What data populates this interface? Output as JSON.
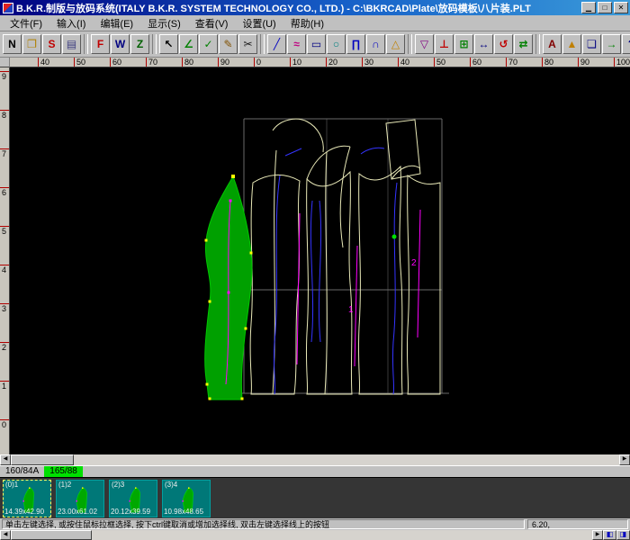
{
  "window": {
    "title": "B.K.R.制版与放码系统(ITALY B.K.R. SYSTEM TECHNOLOGY CO., LTD.) - C:\\BKRCAD\\Plate\\放码模板\\八片装.PLT",
    "buttons": {
      "minimize": "▁",
      "maximize": "□",
      "close": "✕"
    }
  },
  "menu": {
    "items": [
      {
        "name": "file",
        "label": "文件(F)"
      },
      {
        "name": "input",
        "label": "输入(I)"
      },
      {
        "name": "edit",
        "label": "编辑(E)"
      },
      {
        "name": "display",
        "label": "显示(S)"
      },
      {
        "name": "view",
        "label": "查看(V)"
      },
      {
        "name": "settings",
        "label": "设置(U)"
      },
      {
        "name": "help",
        "label": "帮助(H)"
      }
    ]
  },
  "toolbar": {
    "items": [
      {
        "name": "new",
        "glyph": "N",
        "color": "#000000"
      },
      {
        "name": "open",
        "glyph": "❐",
        "color": "#b08000"
      },
      {
        "name": "save",
        "glyph": "S",
        "color": "#c00000"
      },
      {
        "name": "print",
        "glyph": "▤",
        "color": "#404080"
      },
      {
        "sep": true
      },
      {
        "name": "pattern-f",
        "glyph": "F",
        "color": "#c00000"
      },
      {
        "name": "pattern-w",
        "glyph": "W",
        "color": "#000080"
      },
      {
        "name": "zoom",
        "glyph": "Z",
        "color": "#006000"
      },
      {
        "sep": true
      },
      {
        "name": "select",
        "glyph": "↖",
        "color": "#000000"
      },
      {
        "name": "measure-angle",
        "glyph": "∠",
        "color": "#008000"
      },
      {
        "name": "confirm",
        "glyph": "✓",
        "color": "#008000"
      },
      {
        "name": "pencil",
        "glyph": "✎",
        "color": "#805000"
      },
      {
        "name": "scissors",
        "glyph": "✂",
        "color": "#202020"
      },
      {
        "sep": true
      },
      {
        "name": "line",
        "glyph": "╱",
        "color": "#0000c0"
      },
      {
        "name": "curve",
        "glyph": "≈",
        "color": "#c00080"
      },
      {
        "name": "rectangle",
        "glyph": "▭",
        "color": "#000080"
      },
      {
        "name": "circle",
        "glyph": "○",
        "color": "#008080"
      },
      {
        "name": "pi-tool",
        "glyph": "∏",
        "color": "#0000c0"
      },
      {
        "name": "arc",
        "glyph": "∩",
        "color": "#0000c0"
      },
      {
        "name": "triangle",
        "glyph": "△",
        "color": "#c08000"
      },
      {
        "sep": true
      },
      {
        "name": "dart",
        "glyph": "▽",
        "color": "#800080"
      },
      {
        "name": "notch",
        "glyph": "⊥",
        "color": "#c00000"
      },
      {
        "name": "grade-table",
        "glyph": "⊞",
        "color": "#008000"
      },
      {
        "name": "move",
        "glyph": "↔",
        "color": "#000080"
      },
      {
        "name": "rotate",
        "glyph": "↺",
        "color": "#c00000"
      },
      {
        "name": "mirror",
        "glyph": "⇄",
        "color": "#008000"
      },
      {
        "sep": true
      },
      {
        "name": "text",
        "glyph": "A",
        "color": "#800000"
      },
      {
        "name": "grading",
        "glyph": "▲",
        "color": "#c08000"
      },
      {
        "name": "layers",
        "glyph": "❏",
        "color": "#000080"
      },
      {
        "name": "export",
        "glyph": "→",
        "color": "#008000"
      },
      {
        "name": "help-tool",
        "glyph": "?",
        "color": "#000080"
      }
    ]
  },
  "rulers": {
    "horizontal": [
      "40",
      "50",
      "60",
      "70",
      "80",
      "90",
      "0",
      "10",
      "20",
      "30",
      "40",
      "50",
      "60",
      "70",
      "80",
      "90",
      "100"
    ],
    "vertical": [
      "9",
      "8",
      "7",
      "6",
      "5",
      "4",
      "3",
      "2",
      "1",
      "0"
    ]
  },
  "canvas": {
    "annotations": [
      {
        "text": "1"
      },
      {
        "text": "2"
      }
    ],
    "colors": {
      "background": "#000000",
      "pattern_outline": "#e9e9b8",
      "construction_grid": "#6a6a6a",
      "curve_line": "#3434ff",
      "grading_line": "#ff00ff",
      "selected_piece_fill": "#00a000",
      "grading_point": "#ffff00",
      "snap_point": "#00e000"
    }
  },
  "scrollbars": {
    "left": "◀",
    "right": "▶"
  },
  "bottom_buttons": [
    {
      "name": "piece-nav-left",
      "glyph": "◧"
    },
    {
      "name": "piece-nav-right",
      "glyph": "◨"
    }
  ],
  "size_bar": {
    "tabs": [
      {
        "label": "160/84A",
        "selected": false
      },
      {
        "label": "165/88",
        "selected": true
      }
    ]
  },
  "pieces": [
    {
      "code": "(0)1",
      "dims": "14.39x42.90",
      "selected": true
    },
    {
      "code": "(1)2",
      "dims": "23.00x61.02",
      "selected": false
    },
    {
      "code": "(2)3",
      "dims": "20.12x39.59",
      "selected": false
    },
    {
      "code": "(3)4",
      "dims": "10.98x48.65",
      "selected": false
    }
  ],
  "status": {
    "message": "单击左键选择, 或按住鼠标拉框选择, 按下ctrl键取消或增加选择线, 双击左键选择线上的按钮",
    "coords": "6.20,"
  }
}
